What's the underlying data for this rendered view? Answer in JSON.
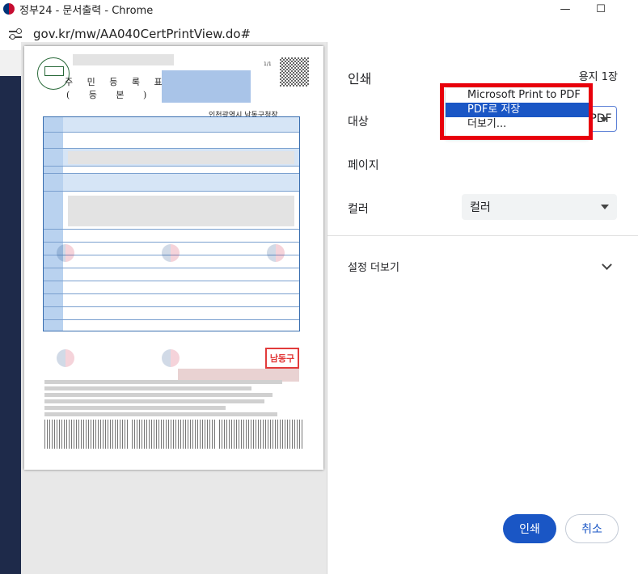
{
  "window": {
    "title": "정부24 - 문서출력 - Chrome",
    "url": "gov.kr/mw/AA040CertPrintView.do#",
    "controls": {
      "minimize": "—",
      "maximize": "☐"
    }
  },
  "document": {
    "page_marker": "1/1",
    "title": "주 민 등 록 표",
    "subtitle": "( 등 본 )",
    "issuing_office": "인천광역시 남동구청장",
    "stamp_text": "남동구"
  },
  "print_dialog": {
    "heading": "인쇄",
    "sheet_count": "용지 1장",
    "destination": {
      "label": "대상",
      "selected": "Microsoft Print to PDF",
      "options": [
        "Microsoft Print to PDF",
        "PDF로 저장",
        "더보기..."
      ],
      "highlighted_index": 1
    },
    "pages": {
      "label": "페이지"
    },
    "color": {
      "label": "컬러",
      "value": "컬러"
    },
    "more_settings": "설정 더보기",
    "buttons": {
      "print": "인쇄",
      "cancel": "취소"
    },
    "colors": {
      "accent": "#1a56c5",
      "highlight_box": "#e8000b"
    }
  }
}
